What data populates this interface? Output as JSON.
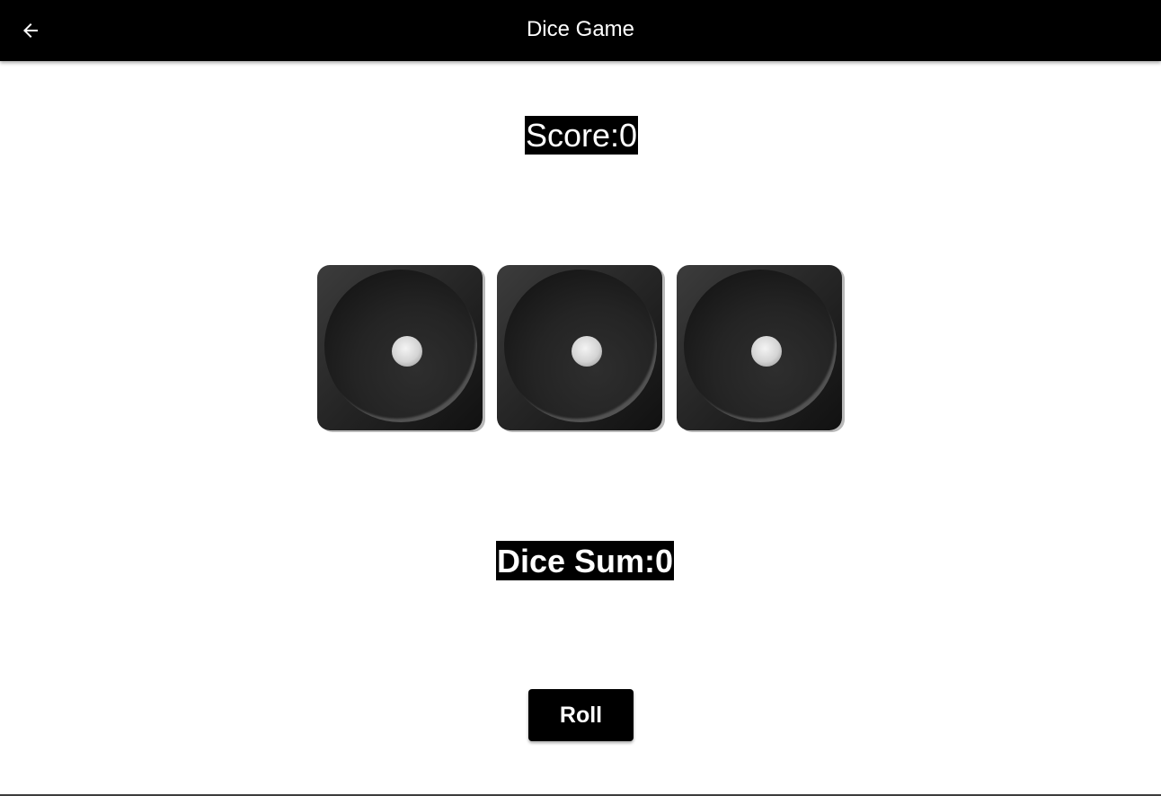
{
  "app_bar": {
    "title": "Dice Game",
    "back_icon": "arrow-left-icon"
  },
  "score": {
    "label": "Score:",
    "value": "0",
    "text": "Score:0"
  },
  "dice": [
    {
      "value": 1,
      "pip_icon": "die-pip"
    },
    {
      "value": 1,
      "pip_icon": "die-pip"
    },
    {
      "value": 1,
      "pip_icon": "die-pip"
    }
  ],
  "dice_sum": {
    "label": "Dice Sum:",
    "value": "0",
    "text": "Dice Sum:0"
  },
  "roll_button": {
    "label": "Roll"
  },
  "colors": {
    "app_bar_bg": "#000000",
    "text_light": "#ffffff",
    "page_bg": "#ffffff",
    "die_body": "#252525"
  }
}
